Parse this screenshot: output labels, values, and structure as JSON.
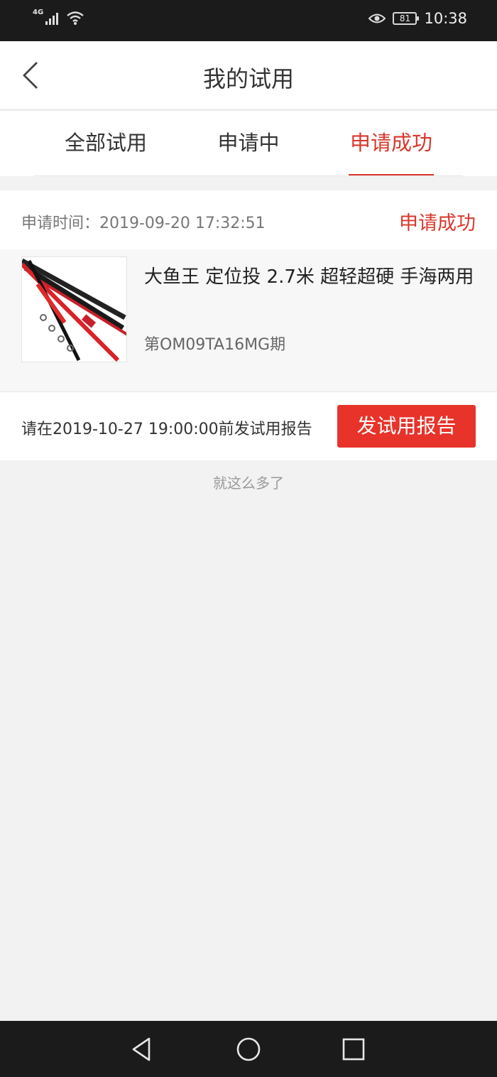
{
  "status_bar": {
    "network": "4G",
    "battery": "81",
    "time": "10:38",
    "icons": [
      "signal-icon",
      "wifi-icon",
      "eye-icon",
      "battery-icon"
    ]
  },
  "header": {
    "title": "我的试用",
    "back_icon": "chevron-left-icon"
  },
  "tabs": [
    {
      "label": "全部试用",
      "active": false
    },
    {
      "label": "申请中",
      "active": false
    },
    {
      "label": "申请成功",
      "active": true
    }
  ],
  "card": {
    "apply_label": "申请时间：2019-09-20 17:32:51",
    "status": "申请成功",
    "product": {
      "name": "大鱼王 定位投 2.7米 超轻超硬 手海两用",
      "period": "第OM09TA16MG期",
      "image_icon": "fishing-rod-image"
    },
    "deadline": "请在2019-10-27 19:00:00前发试用报告",
    "report_button": "发试用报告"
  },
  "end_text": "就这么多了",
  "nav_bar": {
    "icons": [
      "back-triangle-icon",
      "home-circle-icon",
      "recents-square-icon"
    ]
  },
  "colors": {
    "accent": "#d9382b",
    "button": "#e8332a",
    "background": "#f2f2f2",
    "status_bar": "#1b1b1b"
  }
}
